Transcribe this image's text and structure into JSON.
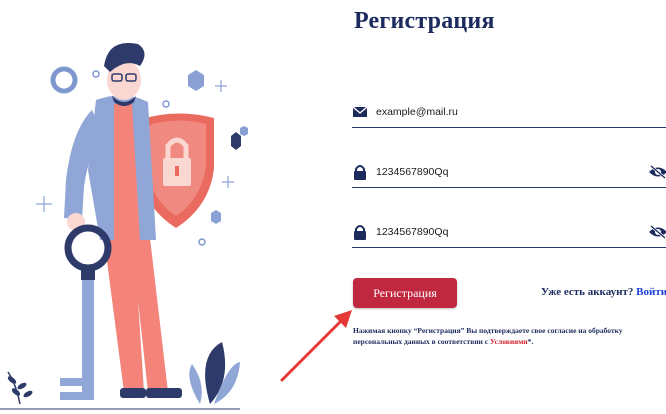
{
  "page": {
    "title": "Регистрация"
  },
  "form": {
    "email": {
      "value": "example@mail.ru",
      "icon": "envelope-icon"
    },
    "password": {
      "value": "1234567890Qq",
      "icon": "lock-icon",
      "toggle_icon": "eye-slash-icon"
    },
    "password_confirm": {
      "value": "1234567890Qq",
      "icon": "lock-icon",
      "toggle_icon": "eye-slash-icon"
    },
    "submit_label": "Регистрация"
  },
  "login_prompt": {
    "text": "Уже есть аккаунт?",
    "link": "Войти"
  },
  "agreement": {
    "text_before": "Нажимая кнопку “Регистрация” Вы подтверждаете свое согласие на обработку персональных данных в соответствии с ",
    "link": "Условиями",
    "text_after": "*."
  },
  "colors": {
    "accent": "#c0283f",
    "navy": "#1c2b5e",
    "link": "#1a3fd4",
    "annotation_arrow": "#e53935"
  }
}
